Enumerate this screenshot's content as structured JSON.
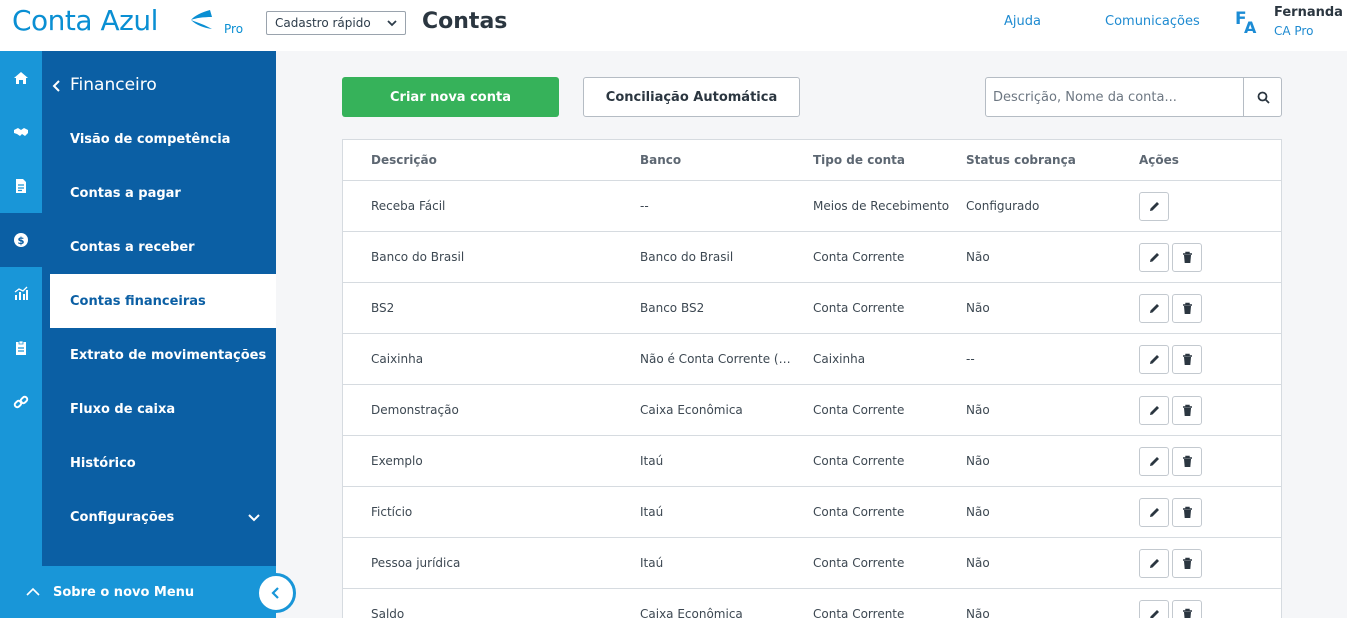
{
  "brand": {
    "name": "Conta Azul",
    "plan_tag": "Pro",
    "accent": "#0a8fd3",
    "sidebar_dark": "#0b5fa4",
    "sidebar_light": "#1996d8",
    "primary_green": "#36b25a"
  },
  "header": {
    "quick_register": "Cadastro rápido",
    "title": "Contas",
    "links": {
      "help": "Ajuda",
      "communications": "Comunicações"
    },
    "user": {
      "initials_f": "F",
      "initials_a": "A",
      "name": "Fernanda",
      "plan": "CA Pro"
    }
  },
  "rail": [
    "home-icon",
    "handshake-icon",
    "document-icon",
    "dollar-icon",
    "chart-icon",
    "clipboard-icon",
    "link-icon"
  ],
  "sidebar": {
    "section": "Financeiro",
    "items": [
      {
        "label": "Visão de competência"
      },
      {
        "label": "Contas a pagar"
      },
      {
        "label": "Contas a receber"
      },
      {
        "label": "Contas financeiras"
      },
      {
        "label": "Extrato de movimentações"
      },
      {
        "label": "Fluxo de caixa"
      },
      {
        "label": "Histórico"
      },
      {
        "label": "Configurações"
      }
    ],
    "footer": "Sobre o novo Menu"
  },
  "actions": {
    "create": "Criar nova conta",
    "reconcile": "Conciliação Automática"
  },
  "search": {
    "placeholder": "Descrição, Nome da conta...",
    "value": ""
  },
  "table": {
    "columns": {
      "description": "Descrição",
      "bank": "Banco",
      "type": "Tipo de conta",
      "status": "Status cobrança",
      "actions": "Ações"
    },
    "rows": [
      {
        "description": "Receba Fácil",
        "bank": "--",
        "type": "Meios de Recebimento",
        "status": "Configurado",
        "deletable": false
      },
      {
        "description": "Banco do Brasil",
        "bank": "Banco do Brasil",
        "type": "Conta Corrente",
        "status": "Não",
        "deletable": true
      },
      {
        "description": "BS2",
        "bank": "Banco BS2",
        "type": "Conta Corrente",
        "status": "Não",
        "deletable": true
      },
      {
        "description": "Caixinha",
        "bank": "Não é Conta Corrente (E...",
        "type": "Caixinha",
        "status": "--",
        "deletable": true
      },
      {
        "description": "Demonstração",
        "bank": "Caixa Econômica",
        "type": "Conta Corrente",
        "status": "Não",
        "deletable": true
      },
      {
        "description": "Exemplo",
        "bank": "Itaú",
        "type": "Conta Corrente",
        "status": "Não",
        "deletable": true
      },
      {
        "description": "Fictício",
        "bank": "Itaú",
        "type": "Conta Corrente",
        "status": "Não",
        "deletable": true
      },
      {
        "description": "Pessoa jurídica",
        "bank": "Itaú",
        "type": "Conta Corrente",
        "status": "Não",
        "deletable": true
      },
      {
        "description": "Saldo",
        "bank": "Caixa Econômica",
        "type": "Conta Corrente",
        "status": "Não",
        "deletable": true
      }
    ]
  }
}
